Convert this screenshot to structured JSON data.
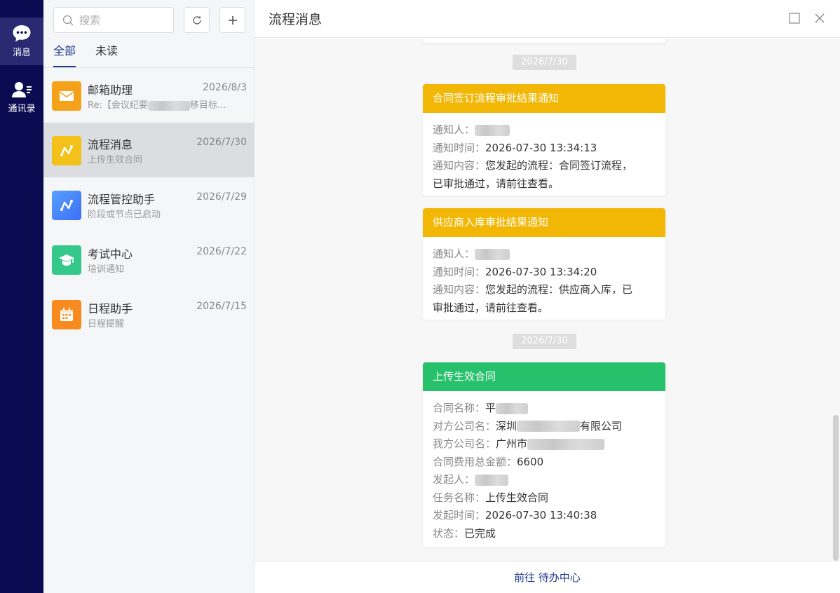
{
  "rail": {
    "messages_label": "消息",
    "contacts_label": "通讯录"
  },
  "search": {
    "placeholder": "搜索"
  },
  "tabs": {
    "all": "全部",
    "unread": "未读"
  },
  "conversations": [
    {
      "name": "邮箱助理",
      "date": "2026/8/3",
      "preview_prefix": "Re:【会议纪要",
      "preview_suffix": "移目标…",
      "icon": "mail-icon",
      "color": "#f5a21a"
    },
    {
      "name": "流程消息",
      "date": "2026/7/30",
      "preview": "上传生效合同",
      "icon": "flow-icon",
      "color": "#f2c21a"
    },
    {
      "name": "流程管控助手",
      "date": "2026/7/29",
      "preview": "阶段或节点已启动",
      "icon": "flow-icon",
      "color": "#3b82f6"
    },
    {
      "name": "考试中心",
      "date": "2026/7/22",
      "preview": "培训通知",
      "icon": "graduation-cap-icon",
      "color": "#34c98a"
    },
    {
      "name": "日程助手",
      "date": "2026/7/15",
      "preview": "日程提醒",
      "icon": "calendar-icon",
      "color": "#f78b1f"
    }
  ],
  "header": {
    "title": "流程消息"
  },
  "chat": {
    "dates": [
      "2026/7/30",
      "2026/7/30"
    ],
    "card1": {
      "title": "合同签订流程审批结果通知",
      "color": "#f2b705",
      "notifier_label": "通知人：",
      "time_label": "通知时间：",
      "time_value": "2026-07-30 13:34:13",
      "content_label": "通知内容：",
      "content_value1": "您发起的流程：合同签订流程，",
      "content_value2": "已审批通过，请前往查看。"
    },
    "card2": {
      "title": "供应商入库审批结果通知",
      "color": "#f2b705",
      "notifier_label": "通知人：",
      "time_label": "通知时间：",
      "time_value": "2026-07-30 13:34:20",
      "content_label": "通知内容：",
      "content_value1": "您发起的流程：供应商入库，已",
      "content_value2": "审批通过，请前往查看。"
    },
    "card3": {
      "title": "上传生效合同",
      "color": "#27c06b",
      "contract_name_label": "合同名称：",
      "contract_name_value": "平",
      "counterparty_label": "对方公司名：",
      "counterparty_prefix": "深圳",
      "counterparty_suffix": "有限公司",
      "our_company_label": "我方公司名：",
      "our_company_value": "广州市",
      "amount_label": "合同费用总金额：",
      "amount_value": "6600",
      "initiator_label": "发起人：",
      "task_label": "任务名称：",
      "task_value": "上传生效合同",
      "start_time_label": "发起时间：",
      "start_time_value": "2026-07-30 13:40:38",
      "status_label": "状态：",
      "status_value": "已完成"
    }
  },
  "footer": {
    "link": "前往 待办中心"
  }
}
